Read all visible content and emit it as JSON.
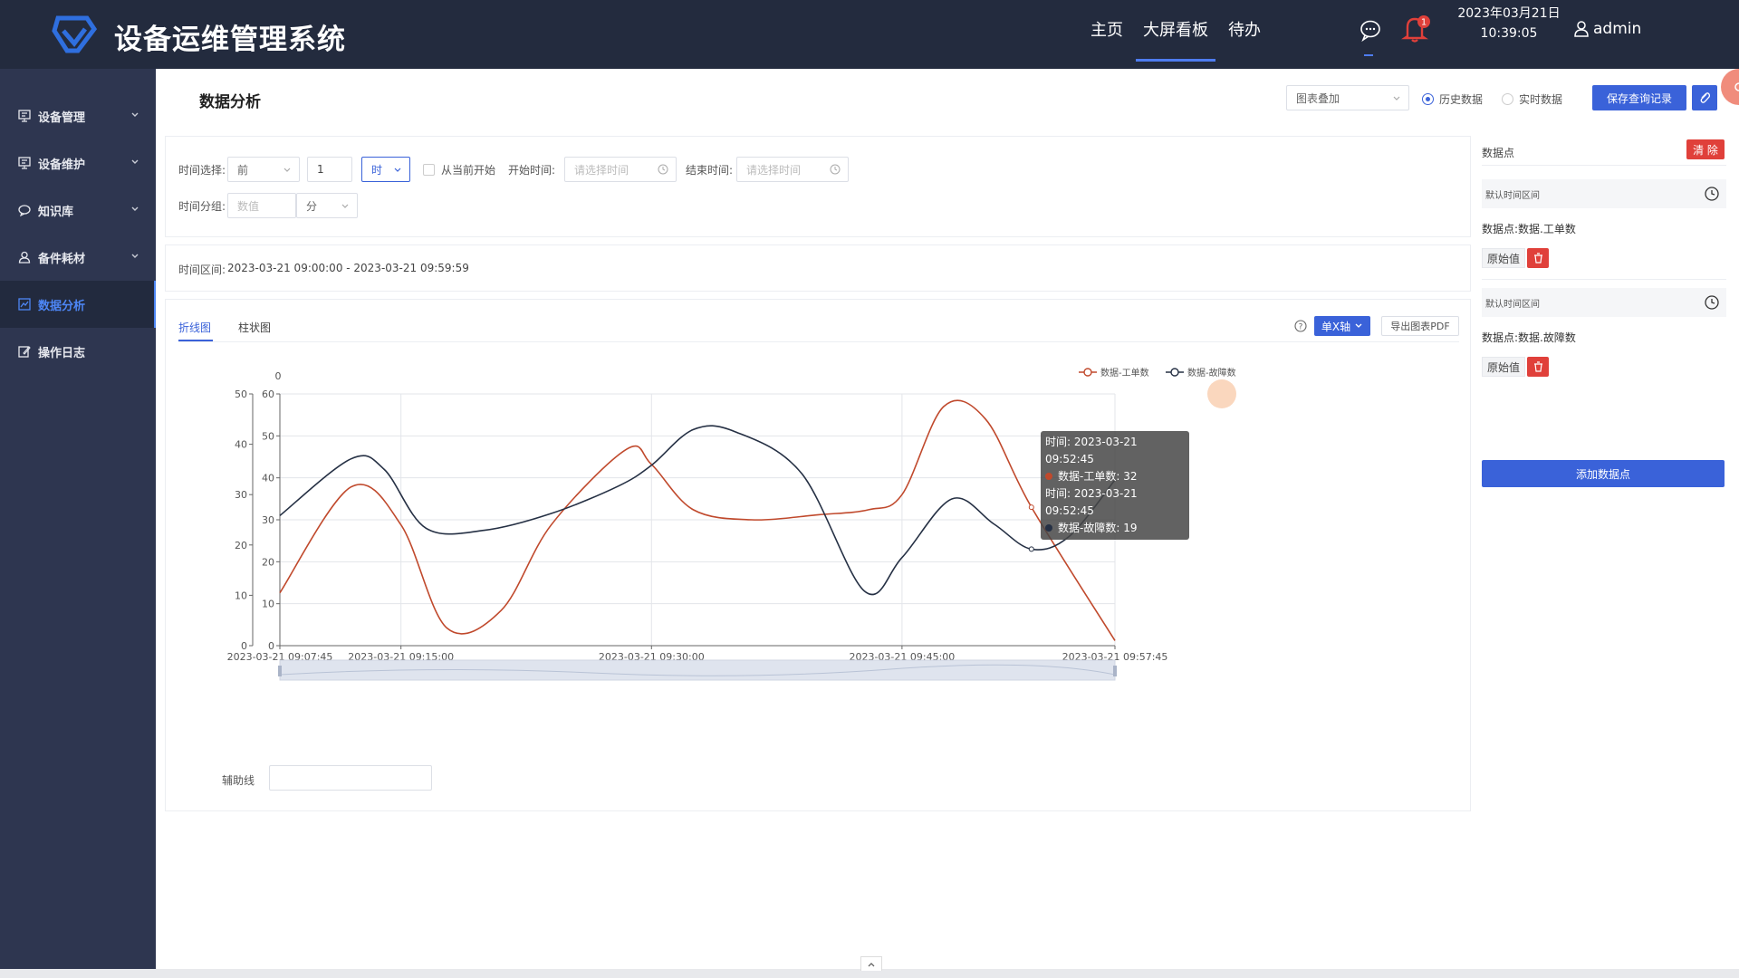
{
  "header": {
    "app_title": "设备运维管理系统",
    "nav": [
      {
        "label": "主页"
      },
      {
        "label": "大屏看板"
      },
      {
        "label": "待办"
      }
    ],
    "notification_count": "1",
    "date": "2023年03月21日",
    "time": "10:39:05",
    "username": "admin"
  },
  "sidebar": {
    "items": [
      {
        "label": "设备管理",
        "icon": "monitor-icon"
      },
      {
        "label": "设备维护",
        "icon": "monitor-icon"
      },
      {
        "label": "知识库",
        "icon": "chat-icon"
      },
      {
        "label": "备件耗材",
        "icon": "user-icon"
      },
      {
        "label": "数据分析",
        "icon": "chart-icon"
      },
      {
        "label": "操作日志",
        "icon": "edit-icon"
      }
    ],
    "active_index": 4
  },
  "toolbar": {
    "page_title": "数据分析",
    "chart_overlay_select": "图表叠加",
    "radio_history": "历史数据",
    "radio_realtime": "实时数据",
    "selected_radio": "历史数据",
    "save_button": "保存查询记录"
  },
  "filters": {
    "time_select_label": "时间选择:",
    "direction_value": "前",
    "amount_value": "1",
    "unit_value": "时",
    "from_now_label": "从当前开始",
    "start_time_label": "开始时间:",
    "start_time_placeholder": "请选择时间",
    "end_time_label": "结束时间:",
    "end_time_placeholder": "请选择时间",
    "group_label": "时间分组:",
    "group_placeholder": "数值",
    "group_unit": "分"
  },
  "interval": {
    "label": "时间区间:",
    "value": "2023-03-21 09:00:00 - 2023-03-21 09:59:59"
  },
  "chart_panel": {
    "tabs": [
      "折线图",
      "柱状图"
    ],
    "active_tab": "折线图",
    "axis_mode_button": "单X轴",
    "export_button": "导出图表PDF",
    "aux_line_label": "辅助线",
    "aux_line_value": ""
  },
  "chart_data": {
    "type": "line",
    "title": "",
    "xlabel": "",
    "ylabel": "",
    "x_range": [
      "2023-03-21 09:07:45",
      "2023-03-21 09:57:45"
    ],
    "x_tick_labels": [
      "2023-03-21 09:07:45",
      "2023-03-21 09:15:00",
      "2023-03-21 09:30:00",
      "2023-03-21 09:45:00",
      "2023-03-21 09:57:45"
    ],
    "left_axis": {
      "ylim": [
        0,
        50
      ],
      "ticks": [
        0,
        10,
        20,
        30,
        40,
        50
      ]
    },
    "right_axis": {
      "ylim": [
        0,
        60
      ],
      "ticks": [
        0,
        10,
        20,
        30,
        40,
        50,
        60
      ],
      "top_label": "0"
    },
    "legend_position": "top-right",
    "grid": true,
    "series": [
      {
        "name": "数据-工单数",
        "color": "#c0492c",
        "axis": "left",
        "points": [
          [
            "2023-03-21 09:07:45",
            10.5
          ],
          [
            "2023-03-21 09:12:00",
            31.5
          ],
          [
            "2023-03-21 09:15:00",
            24
          ],
          [
            "2023-03-21 09:17:45",
            3.5
          ],
          [
            "2023-03-21 09:21:00",
            7
          ],
          [
            "2023-03-21 09:24:00",
            24
          ],
          [
            "2023-03-21 09:28:30",
            39
          ],
          [
            "2023-03-21 09:30:00",
            36
          ],
          [
            "2023-03-21 09:32:30",
            27
          ],
          [
            "2023-03-21 09:36:00",
            25
          ],
          [
            "2023-03-21 09:40:00",
            26
          ],
          [
            "2023-03-21 09:43:00",
            27
          ],
          [
            "2023-03-21 09:45:00",
            30
          ],
          [
            "2023-03-21 09:47:30",
            47.5
          ],
          [
            "2023-03-21 09:50:00",
            45
          ],
          [
            "2023-03-21 09:52:45",
            27.5
          ],
          [
            "2023-03-21 09:57:45",
            1
          ]
        ]
      },
      {
        "name": "数据-故障数",
        "color": "#253044",
        "axis": "right",
        "points": [
          [
            "2023-03-21 09:07:45",
            31
          ],
          [
            "2023-03-21 09:12:00",
            44.5
          ],
          [
            "2023-03-21 09:14:00",
            42
          ],
          [
            "2023-03-21 09:16:30",
            28
          ],
          [
            "2023-03-21 09:20:00",
            27.5
          ],
          [
            "2023-03-21 09:24:00",
            31.5
          ],
          [
            "2023-03-21 09:28:00",
            38
          ],
          [
            "2023-03-21 09:30:00",
            43
          ],
          [
            "2023-03-21 09:32:30",
            51.5
          ],
          [
            "2023-03-21 09:35:00",
            51
          ],
          [
            "2023-03-21 09:39:00",
            41
          ],
          [
            "2023-03-21 09:42:45",
            13
          ],
          [
            "2023-03-21 09:45:00",
            21
          ],
          [
            "2023-03-21 09:48:00",
            35
          ],
          [
            "2023-03-21 09:50:30",
            29
          ],
          [
            "2023-03-21 09:52:45",
            23
          ],
          [
            "2023-03-21 09:55:00",
            26
          ],
          [
            "2023-03-21 09:57:45",
            39.5
          ]
        ]
      }
    ],
    "tooltip": {
      "lines": [
        "时间: 2023-03-21 09:52:45",
        "数据-工单数: 32",
        "时间: 2023-03-21 09:52:45",
        "数据-故障数: 19"
      ]
    }
  },
  "datapoints": {
    "title": "数据点",
    "clear_button": "清 除",
    "items": [
      {
        "range_label": "默认时间区间",
        "name": "数据点:数据.工单数",
        "tag": "原始值"
      },
      {
        "range_label": "默认时间区间",
        "name": "数据点:数据.故障数",
        "tag": "原始值"
      }
    ],
    "add_button": "添加数据点"
  }
}
